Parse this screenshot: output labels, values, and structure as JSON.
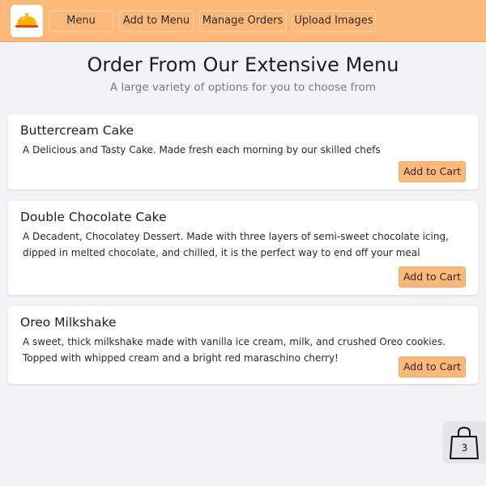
{
  "nav": {
    "logo_icon": "serving-cloche-icon",
    "items": [
      {
        "label": "Menu"
      },
      {
        "label": "Add to Menu"
      },
      {
        "label": "Manage Orders"
      },
      {
        "label": "Upload Images"
      }
    ],
    "colors": {
      "accent": "#fbb878",
      "background": "#f1f3f6"
    }
  },
  "header": {
    "title": "Order From Our Extensive Menu",
    "subtitle": "A large variety of options for you to choose from"
  },
  "menu_items": [
    {
      "name": "Buttercream Cake",
      "description": "A Delicious and Tasty Cake. Made fresh each morning by our skilled chefs",
      "button_label": "Add to Cart"
    },
    {
      "name": "Double Chocolate Cake",
      "description": "A Decadent, Chocolatey Dessert. Made with three layers of semi-sweet chocolate icing, dipped in melted chocolate, and chilled, it is the perfect way to end off your meal",
      "button_label": "Add to Cart"
    },
    {
      "name": "Oreo Milkshake",
      "description": "A sweet, thick milkshake made with vanilla ice cream, milk, and crushed Oreo cookies. Topped with whipped cream and a bright red maraschino cherry!",
      "button_label": "Add to Cart"
    }
  ],
  "cart": {
    "icon": "shopping-bag-icon",
    "count": "3"
  }
}
